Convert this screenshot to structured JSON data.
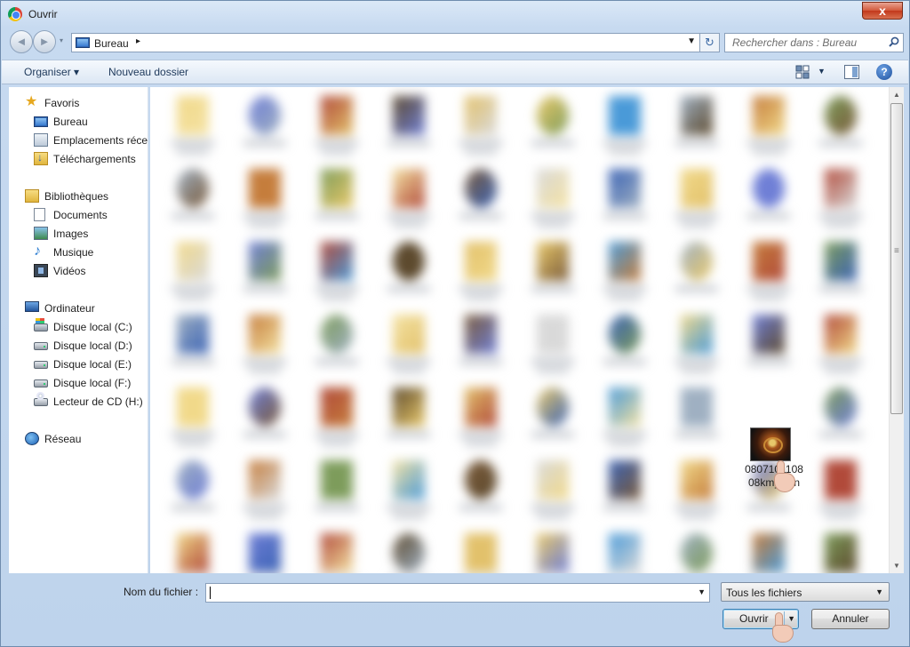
{
  "window": {
    "title": "Ouvrir",
    "close_label": "x"
  },
  "nav": {
    "back_glyph": "◄",
    "forward_glyph": "►",
    "history_glyph": "▾",
    "address_location": "Bureau",
    "address_separator": "▸",
    "address_dropdown_glyph": "▼",
    "refresh_glyph": "↻",
    "search_placeholder": "Rechercher dans : Bureau"
  },
  "toolbar": {
    "organize_label": "Organiser ▾",
    "new_folder_label": "Nouveau dossier",
    "view_dropdown_glyph": "▼",
    "help_label": "?"
  },
  "sidebar": {
    "favorites": {
      "label": "Favoris",
      "icon": "star-icon",
      "items": [
        {
          "label": "Bureau",
          "icon": "desktop-icon"
        },
        {
          "label": "Emplacements récents",
          "icon": "recent-places-icon"
        },
        {
          "label": "Téléchargements",
          "icon": "downloads-icon"
        }
      ]
    },
    "libraries": {
      "label": "Bibliothèques",
      "icon": "libraries-icon",
      "items": [
        {
          "label": "Documents",
          "icon": "document-icon"
        },
        {
          "label": "Images",
          "icon": "image-icon"
        },
        {
          "label": "Musique",
          "icon": "music-icon"
        },
        {
          "label": "Vidéos",
          "icon": "video-icon"
        }
      ]
    },
    "computer": {
      "label": "Ordinateur",
      "icon": "computer-icon",
      "items": [
        {
          "label": "Disque local (C:)",
          "icon": "system-drive-icon"
        },
        {
          "label": "Disque local (D:)",
          "icon": "drive-icon"
        },
        {
          "label": "Disque local (E:)",
          "icon": "drive-icon"
        },
        {
          "label": "Disque local (F:)",
          "icon": "drive-icon"
        },
        {
          "label": "Lecteur de CD (H:)",
          "icon": "cd-drive-icon"
        }
      ]
    },
    "network": {
      "label": "Réseau",
      "icon": "network-icon"
    }
  },
  "files": {
    "visible_file_label": "0807101108 08kmyfc3n",
    "scroll_up_glyph": "▲",
    "scroll_down_glyph": "▼"
  },
  "footer": {
    "filename_label": "Nom du fichier :",
    "filename_value": "",
    "filename_dropdown_glyph": "▼",
    "filter_value": "Tous les fichiers",
    "filter_dropdown_glyph": "▼",
    "open_label": "Ouvrir",
    "open_split_glyph": "▼",
    "cancel_label": "Annuler"
  },
  "colors": {
    "window_frame": "#c7daf0",
    "accent": "#3c7fb1",
    "pane_background": "#ffffff"
  }
}
